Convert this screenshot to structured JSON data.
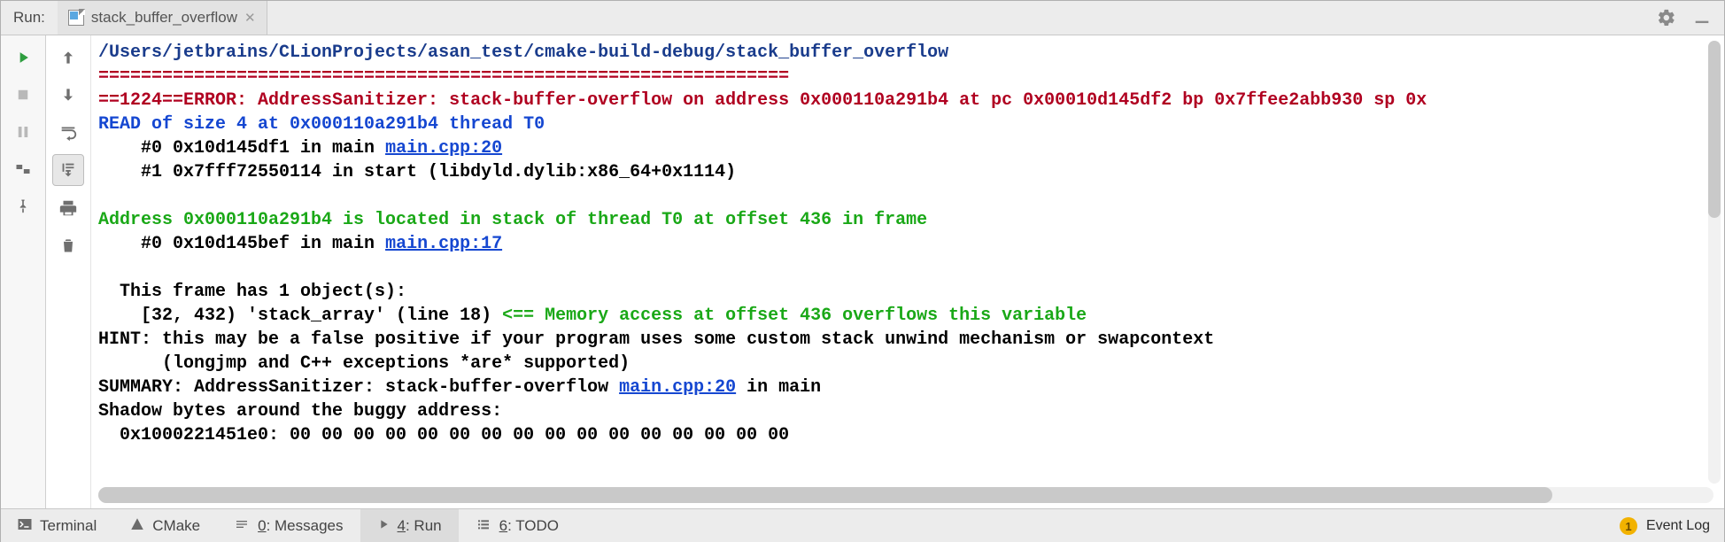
{
  "header": {
    "title": "Run:",
    "tab_label": "stack_buffer_overflow"
  },
  "console": {
    "path": "/Users/jetbrains/CLionProjects/asan_test/cmake-build-debug/stack_buffer_overflow",
    "rule": "=================================================================",
    "error": "==1224==ERROR: AddressSanitizer: stack-buffer-overflow on address 0x000110a291b4 at pc 0x00010d145df2 bp 0x7ffee2abb930 sp 0x",
    "read": "READ of size 4 at 0x000110a291b4 thread T0",
    "frame0_a": "    #0 0x10d145df1 in main ",
    "frame0_link": "main.cpp:20",
    "frame1": "    #1 0x7fff72550114 in start (libdyld.dylib:x86_64+0x1114)",
    "located": "Address 0x000110a291b4 is located in stack of thread T0 at offset 436 in frame",
    "located_f0_a": "    #0 0x10d145bef in main ",
    "located_f0_link": "main.cpp:17",
    "objects_hdr": "  This frame has 1 object(s):",
    "obj_line_a": "    [32, 432) 'stack_array' (line 18) ",
    "obj_line_b": "<== Memory access at offset 436 overflows this variable",
    "hint1": "HINT: this may be a false positive if your program uses some custom stack unwind mechanism or swapcontext",
    "hint2": "      (longjmp and C++ exceptions *are* supported)",
    "summary_a": "SUMMARY: AddressSanitizer: stack-buffer-overflow ",
    "summary_link": "main.cpp:20",
    "summary_b": " in main",
    "shadow_hdr": "Shadow bytes around the buggy address:",
    "shadow_row": "  0x1000221451e0: 00 00 00 00 00 00 00 00 00 00 00 00 00 00 00 00"
  },
  "status": {
    "terminal": "Terminal",
    "cmake": "CMake",
    "messages_u": "0",
    "messages_rest": ": Messages",
    "run_u": "4",
    "run_rest": ": Run",
    "todo_u": "6",
    "todo_rest": ": TODO",
    "event_badge": "1",
    "event_log": "Event Log"
  }
}
